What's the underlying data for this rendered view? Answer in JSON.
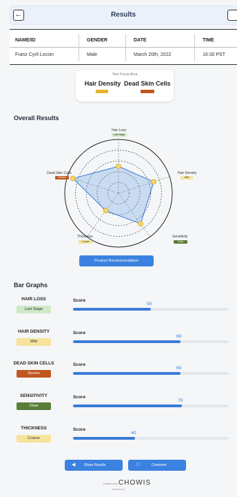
{
  "header": {
    "title": "Results"
  },
  "info": {
    "columns": [
      {
        "header": "NAME/ID",
        "value": "Franz Cyril Locsin"
      },
      {
        "header": "GENDER",
        "value": "Male"
      },
      {
        "header": "DATE",
        "value": "March 20th, 2022"
      },
      {
        "header": "TIME",
        "value": "16:30 PST"
      }
    ]
  },
  "focus": {
    "label": "Your Focus Area",
    "items": [
      {
        "name": "Hair Density",
        "color": "#e8b22e"
      },
      {
        "name": "Dead Skin Cells",
        "color": "#c0571f"
      }
    ]
  },
  "overall": {
    "title": "Overall Results",
    "axes": [
      {
        "name": "Hair Loss",
        "badge": "Last Stage",
        "badge_color": "#cfe8c6",
        "score": 50
      },
      {
        "name": "Hair Density",
        "badge": "Mild",
        "badge_color": "#f7e39a",
        "score": 69
      },
      {
        "name": "Sensitivity",
        "badge": "Clear",
        "badge_color": "#5a7d3a",
        "score": 70
      },
      {
        "name": "Thickness",
        "badge": "Coarse",
        "badge_color": "#f7e39a",
        "score": 40
      },
      {
        "name": "Dead Skin Cells",
        "badge": "Severe",
        "badge_color": "#c0571f",
        "score": 89
      }
    ],
    "button": "Product Recommendation"
  },
  "bars": {
    "title": "Bar Graphs",
    "score_label": "Score",
    "rows": [
      {
        "name": "HAIR LOSS",
        "badge": "Last Stage",
        "badge_color": "#cfe8c6",
        "value": 50
      },
      {
        "name": "HAIR DENSITY",
        "badge": "Mild",
        "badge_color": "#f7e39a",
        "value": 69
      },
      {
        "name": "DEAD SKIN CELLS",
        "badge": "Severe",
        "badge_color": "#c0571f",
        "value": 69
      },
      {
        "name": "SENSITIVITY",
        "badge": "Clear",
        "badge_color": "#5a7d3a",
        "value": 70
      },
      {
        "name": "THICKNESS",
        "badge": "Coarse",
        "badge_color": "#f7e39a",
        "value": 40
      }
    ],
    "accent": "#3b7bd8"
  },
  "footer": {
    "share": "Share Results",
    "comment": "Comment",
    "powered": "Powered by",
    "brand": "CHOWIS",
    "brand_sub": "chowis.com"
  }
}
